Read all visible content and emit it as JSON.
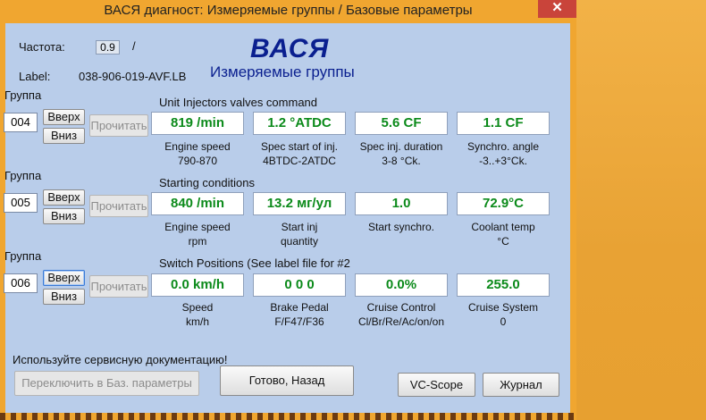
{
  "window": {
    "title": "ВАСЯ диагност: Измеряемые группы / Базовые параметры",
    "close_symbol": "✕"
  },
  "header": {
    "freq_label": "Частота:",
    "freq_value": "0.9",
    "freq_sep": "/",
    "label_label": "Label:",
    "label_value": "038-906-019-AVF.LB",
    "brand": "ВАСЯ",
    "subtitle": "Измеряемые группы"
  },
  "groups": [
    {
      "group_label": "Группа",
      "number": "004",
      "up": "Вверх",
      "down": "Вниз",
      "read": "Прочитать",
      "title": "Unit Injectors valves command",
      "cells": [
        {
          "value": "819 /min",
          "name": "Engine speed",
          "spec": "790-870"
        },
        {
          "value": "1.2 °ATDC",
          "name": "Spec start of inj.",
          "spec": "4BTDC-2ATDC"
        },
        {
          "value": "5.6 CF",
          "name": "Spec inj. duration",
          "spec": "3-8 °Ck."
        },
        {
          "value": "1.1 CF",
          "name": "Synchro. angle",
          "spec": "-3..+3°Ck."
        }
      ]
    },
    {
      "group_label": "Группа",
      "number": "005",
      "up": "Вверх",
      "down": "Вниз",
      "read": "Прочитать",
      "title": "Starting conditions",
      "cells": [
        {
          "value": "840 /min",
          "name": "Engine speed",
          "spec": "rpm"
        },
        {
          "value": "13.2 мг/ул",
          "name": "Start inj",
          "spec": "quantity"
        },
        {
          "value": "1.0",
          "name": "Start synchro.",
          "spec": ""
        },
        {
          "value": "72.9°C",
          "name": "Coolant temp",
          "spec": "°C"
        }
      ]
    },
    {
      "group_label": "Группа",
      "number": "006",
      "up": "Вверх",
      "down": "Вниз",
      "read": "Прочитать",
      "title": "Switch Positions (See label file for #2",
      "cells": [
        {
          "value": "0.0 km/h",
          "name": "Speed",
          "spec": "km/h"
        },
        {
          "value": "0  0  0",
          "name": "Brake Pedal",
          "spec": "F/F47/F36"
        },
        {
          "value": "0.0%",
          "name": "Cruise Control",
          "spec": "Cl/Br/Re/Ac/on/on"
        },
        {
          "value": "255.0",
          "name": "Cruise System",
          "spec": "0"
        }
      ]
    }
  ],
  "footer": {
    "notice": "Используйте сервисную документацию!",
    "switch_btn": "Переключить в Баз. параметры",
    "done_btn": "Готово, Назад",
    "vcscope_btn": "VC-Scope",
    "journal_btn": "Журнал"
  }
}
